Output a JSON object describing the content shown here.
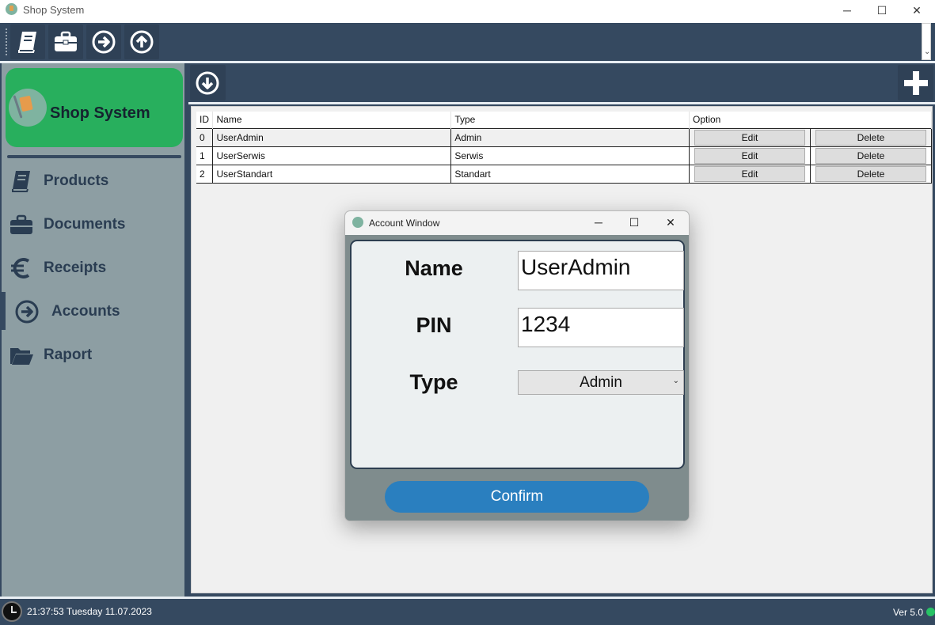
{
  "window": {
    "title": "Shop System",
    "minimize": "─",
    "maximize": "☐",
    "close": "✕"
  },
  "toolbar": {
    "items": [
      "book-icon",
      "briefcase-icon",
      "arrow-right-circle-icon",
      "arrow-up-circle-icon"
    ]
  },
  "sidebar": {
    "brand": "Shop System",
    "items": [
      {
        "label": "Products",
        "icon": "book-icon"
      },
      {
        "label": "Documents",
        "icon": "briefcase-icon"
      },
      {
        "label": "Receipts",
        "icon": "euro-icon"
      },
      {
        "label": "Accounts",
        "icon": "arrow-right-circle-icon",
        "active": true
      },
      {
        "label": "Raport",
        "icon": "folder-open-icon"
      }
    ]
  },
  "main": {
    "table": {
      "headers": [
        "ID",
        "Name",
        "Type",
        "Option"
      ],
      "rows": [
        {
          "id": "0",
          "name": "UserAdmin",
          "type": "Admin",
          "edit": "Edit",
          "delete": "Delete"
        },
        {
          "id": "1",
          "name": "UserSerwis",
          "type": "Serwis",
          "edit": "Edit",
          "delete": "Delete"
        },
        {
          "id": "2",
          "name": "UserStandart",
          "type": "Standart",
          "edit": "Edit",
          "delete": "Delete"
        }
      ]
    }
  },
  "dialog": {
    "title": "Account Window",
    "name_label": "Name",
    "name_value": "UserAdmin",
    "pin_label": "PIN",
    "pin_value": "1234",
    "type_label": "Type",
    "type_value": "Admin",
    "confirm": "Confirm"
  },
  "status": {
    "datetime": "21:37:53 Tuesday 11.07.2023",
    "version": "Ver 5.0"
  },
  "colors": {
    "brand": "#28af5d",
    "navy": "#354960",
    "confirm": "#2a7fbf",
    "sidebar": "#8d9ea3"
  }
}
